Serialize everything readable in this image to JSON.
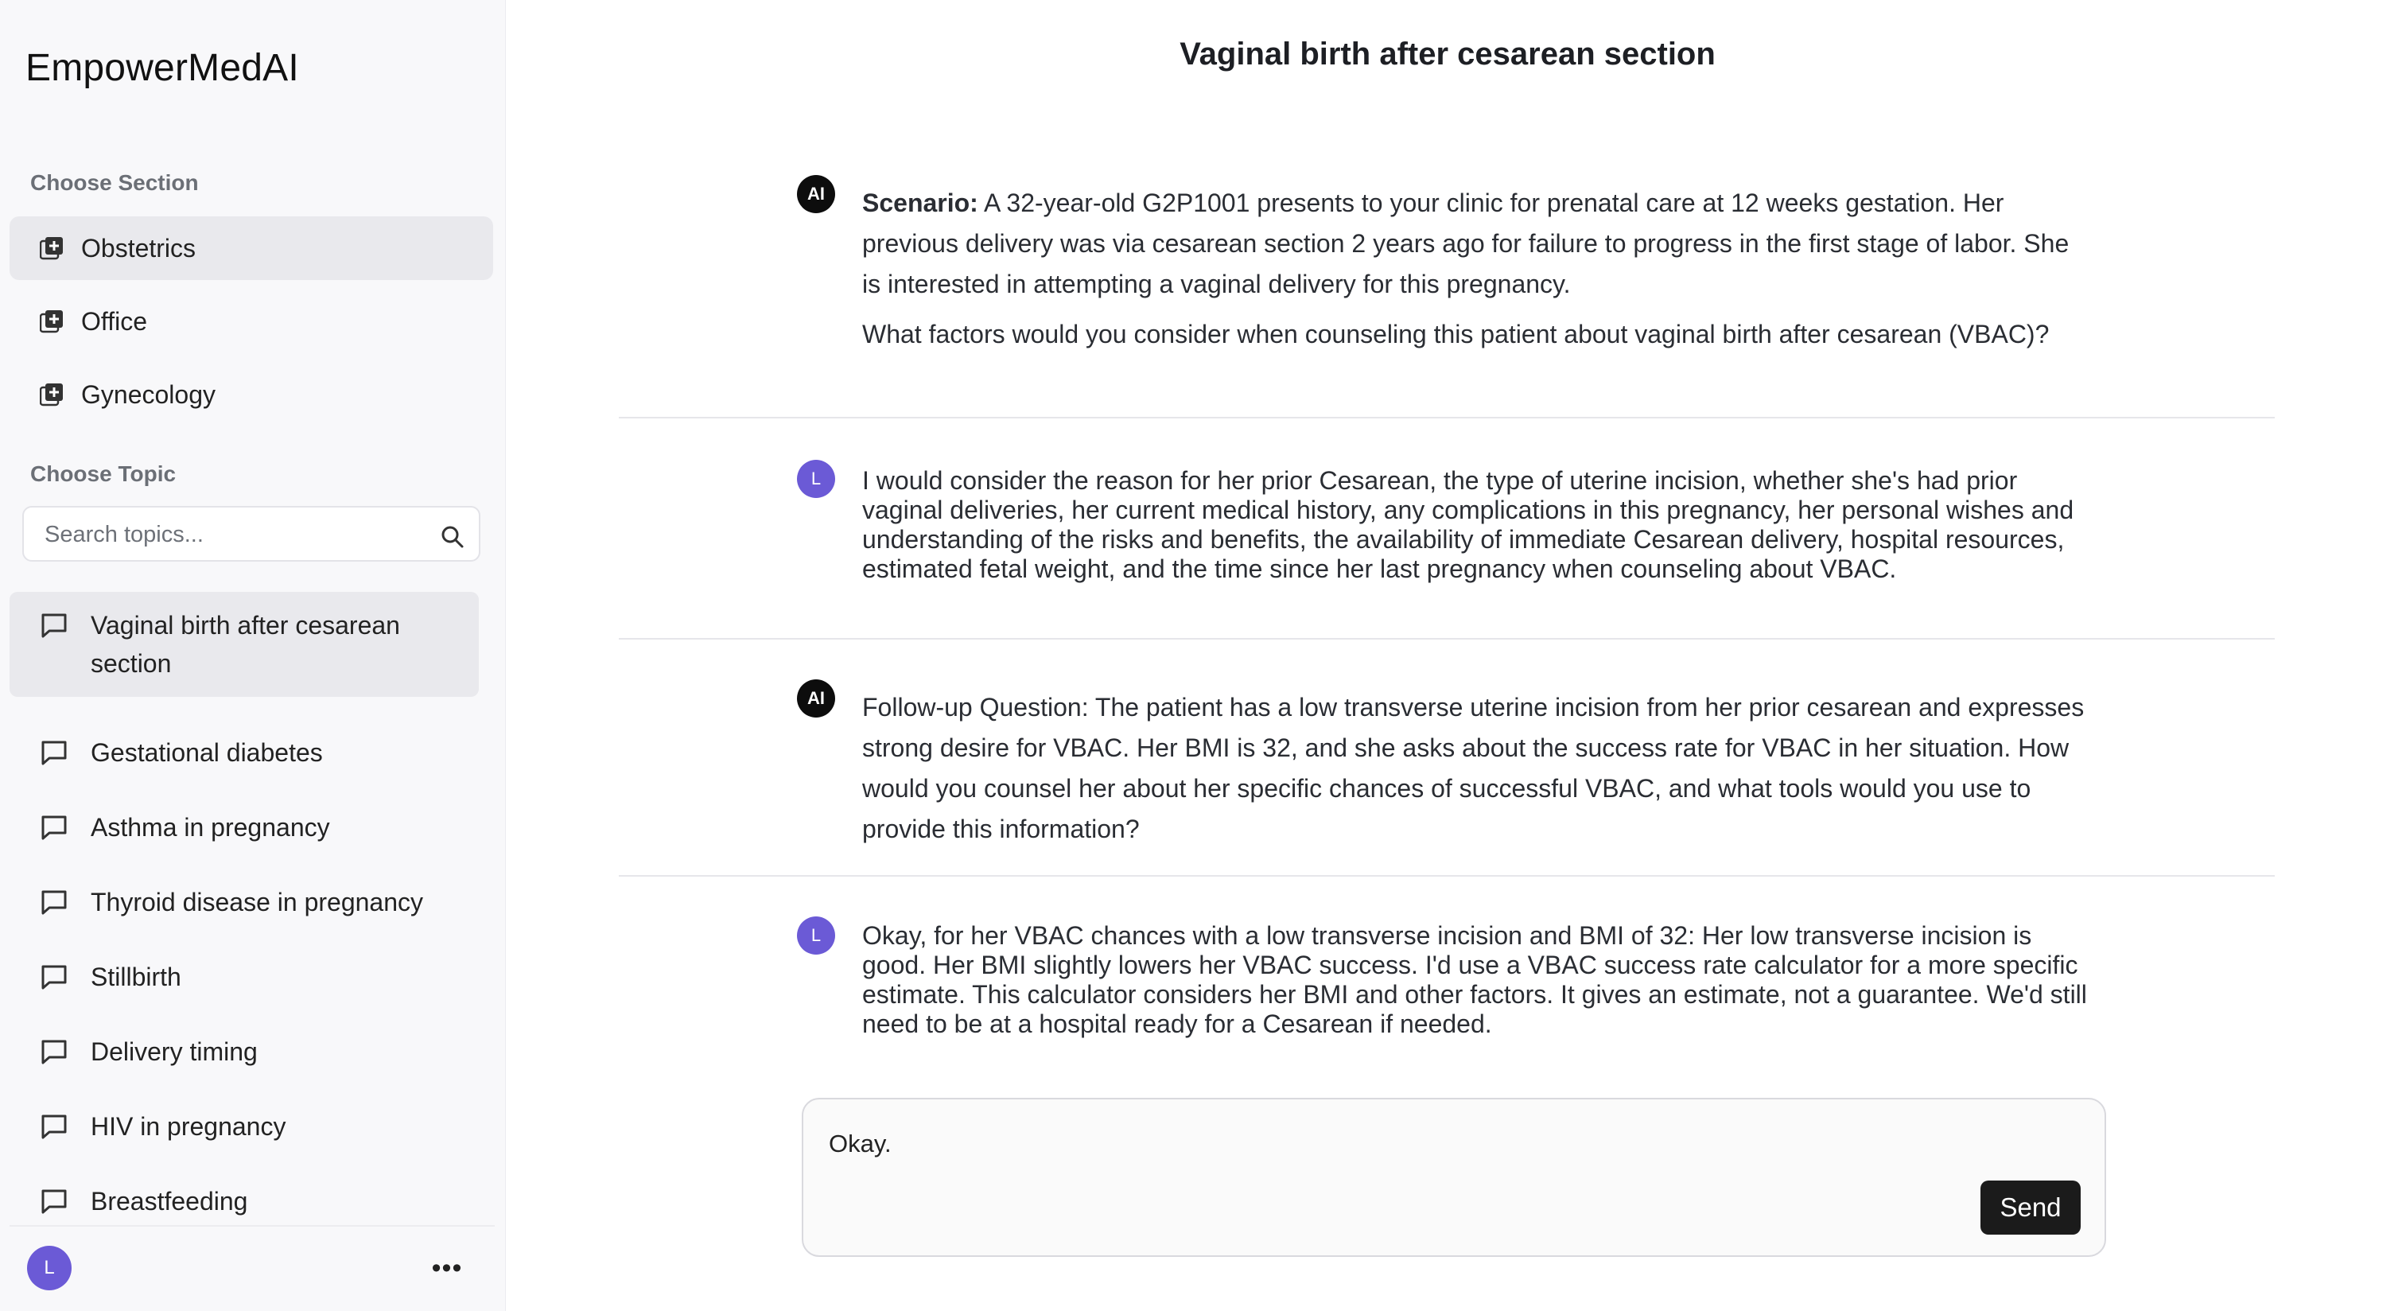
{
  "app": {
    "brand": "EmpowerMedAI"
  },
  "sidebar": {
    "choose_section_label": "Choose Section",
    "sections": [
      {
        "label": "Obstetrics",
        "active": true
      },
      {
        "label": "Office",
        "active": false
      },
      {
        "label": "Gynecology",
        "active": false
      }
    ],
    "choose_topic_label": "Choose Topic",
    "search": {
      "placeholder": "Search topics...",
      "value": ""
    },
    "topics": [
      {
        "label": "Vaginal birth after cesarean section",
        "active": true
      },
      {
        "label": "Gestational diabetes"
      },
      {
        "label": "Asthma in pregnancy"
      },
      {
        "label": "Thyroid disease in pregnancy"
      },
      {
        "label": "Stillbirth"
      },
      {
        "label": "Delivery timing"
      },
      {
        "label": "HIV in pregnancy"
      },
      {
        "label": "Breastfeeding"
      }
    ],
    "footer": {
      "user_initial": "L",
      "more_label": "•••"
    }
  },
  "main": {
    "title": "Vaginal birth after cesarean section",
    "messages": [
      {
        "role": "ai",
        "avatar": "AI",
        "scenario_label": "Scenario:",
        "scenario_text": "A 32-year-old G2P1001 presents to your clinic for prenatal care at 12 weeks gestation. Her previous delivery was via cesarean section 2 years ago for failure to progress in the first stage of labor. She is interested in attempting a vaginal delivery for this pregnancy.",
        "question": "What factors would you consider when counseling this patient about vaginal birth after cesarean (VBAC)?"
      },
      {
        "role": "user",
        "avatar": "L",
        "text": "I would consider the reason for her prior Cesarean, the type of uterine incision, whether she's had prior vaginal deliveries, her current medical history, any complications in this pregnancy, her personal wishes and understanding of the risks and benefits, the availability of immediate Cesarean delivery, hospital resources, estimated fetal weight, and the time since her last pregnancy when counseling about VBAC."
      },
      {
        "role": "ai",
        "avatar": "AI",
        "text": "Follow-up Question: The patient has a low transverse uterine incision from her prior cesarean and expresses strong desire for VBAC. Her BMI is 32, and she asks about the success rate for VBAC in her situation. How would you counsel her about her specific chances of successful VBAC, and what tools would you use to provide this information?"
      },
      {
        "role": "user",
        "avatar": "L",
        "text": "Okay, for her VBAC chances with a low transverse incision and BMI of 32: Her low transverse incision is good. Her BMI slightly lowers her VBAC success. I'd use a VBAC success rate calculator for a more specific estimate. This calculator considers her BMI and other factors. It gives an estimate, not a guarantee. We'd still need to be at a hospital ready for a Cesarean if needed."
      }
    ],
    "composer": {
      "value": "Okay.",
      "send_label": "Send"
    }
  },
  "colors": {
    "accent_user_avatar": "#6b5ad6",
    "ai_avatar": "#0d0d0d",
    "send_button": "#1b1b1b"
  }
}
